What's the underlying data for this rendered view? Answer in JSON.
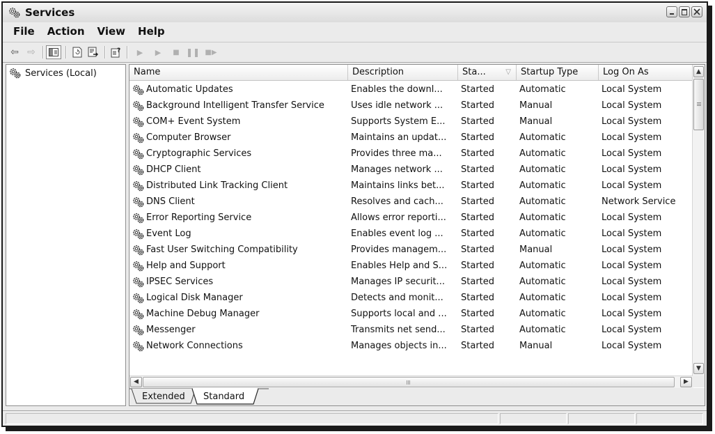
{
  "window": {
    "title": "Services"
  },
  "menu": [
    "File",
    "Action",
    "View",
    "Help"
  ],
  "toolbar": {
    "icons": [
      "back-arrow-icon",
      "forward-arrow-icon",
      "show-hide-tree-icon",
      "refresh-icon",
      "export-list-icon",
      "properties-help-icon",
      "start-service-icon",
      "start-service-alt-icon",
      "stop-service-icon",
      "pause-service-icon",
      "restart-service-icon"
    ]
  },
  "tree": {
    "root_label": "Services (Local)"
  },
  "columns": [
    "Name",
    "Description",
    "Sta...",
    "Startup Type",
    "Log On As"
  ],
  "services": [
    {
      "name": "Automatic Updates",
      "description": "Enables the downl...",
      "status": "Started",
      "startup": "Automatic",
      "logon": "Local System"
    },
    {
      "name": "Background Intelligent Transfer Service",
      "description": "Uses idle network ...",
      "status": "Started",
      "startup": "Manual",
      "logon": "Local System"
    },
    {
      "name": "COM+ Event System",
      "description": "Supports System E...",
      "status": "Started",
      "startup": "Manual",
      "logon": "Local System"
    },
    {
      "name": "Computer Browser",
      "description": "Maintains an updat...",
      "status": "Started",
      "startup": "Automatic",
      "logon": "Local System"
    },
    {
      "name": "Cryptographic Services",
      "description": "Provides three ma...",
      "status": "Started",
      "startup": "Automatic",
      "logon": "Local System"
    },
    {
      "name": "DHCP Client",
      "description": "Manages network ...",
      "status": "Started",
      "startup": "Automatic",
      "logon": "Local System"
    },
    {
      "name": "Distributed Link Tracking Client",
      "description": "Maintains links bet...",
      "status": "Started",
      "startup": "Automatic",
      "logon": "Local System"
    },
    {
      "name": "DNS Client",
      "description": "Resolves and cach...",
      "status": "Started",
      "startup": "Automatic",
      "logon": "Network Service"
    },
    {
      "name": "Error Reporting Service",
      "description": "Allows error reporti...",
      "status": "Started",
      "startup": "Automatic",
      "logon": "Local System"
    },
    {
      "name": "Event Log",
      "description": "Enables event log ...",
      "status": "Started",
      "startup": "Automatic",
      "logon": "Local System"
    },
    {
      "name": "Fast User Switching Compatibility",
      "description": "Provides managem...",
      "status": "Started",
      "startup": "Manual",
      "logon": "Local System"
    },
    {
      "name": "Help and Support",
      "description": "Enables Help and S...",
      "status": "Started",
      "startup": "Automatic",
      "logon": "Local System"
    },
    {
      "name": "IPSEC Services",
      "description": "Manages IP securit...",
      "status": "Started",
      "startup": "Automatic",
      "logon": "Local System"
    },
    {
      "name": "Logical Disk Manager",
      "description": "Detects and monit...",
      "status": "Started",
      "startup": "Automatic",
      "logon": "Local System"
    },
    {
      "name": "Machine Debug Manager",
      "description": "Supports local and ...",
      "status": "Started",
      "startup": "Automatic",
      "logon": "Local System"
    },
    {
      "name": "Messenger",
      "description": "Transmits net send...",
      "status": "Started",
      "startup": "Automatic",
      "logon": "Local System"
    },
    {
      "name": "Network Connections",
      "description": "Manages objects in...",
      "status": "Started",
      "startup": "Manual",
      "logon": "Local System"
    }
  ],
  "tabs": [
    {
      "label": "Extended",
      "active": false
    },
    {
      "label": "Standard",
      "active": true
    }
  ]
}
